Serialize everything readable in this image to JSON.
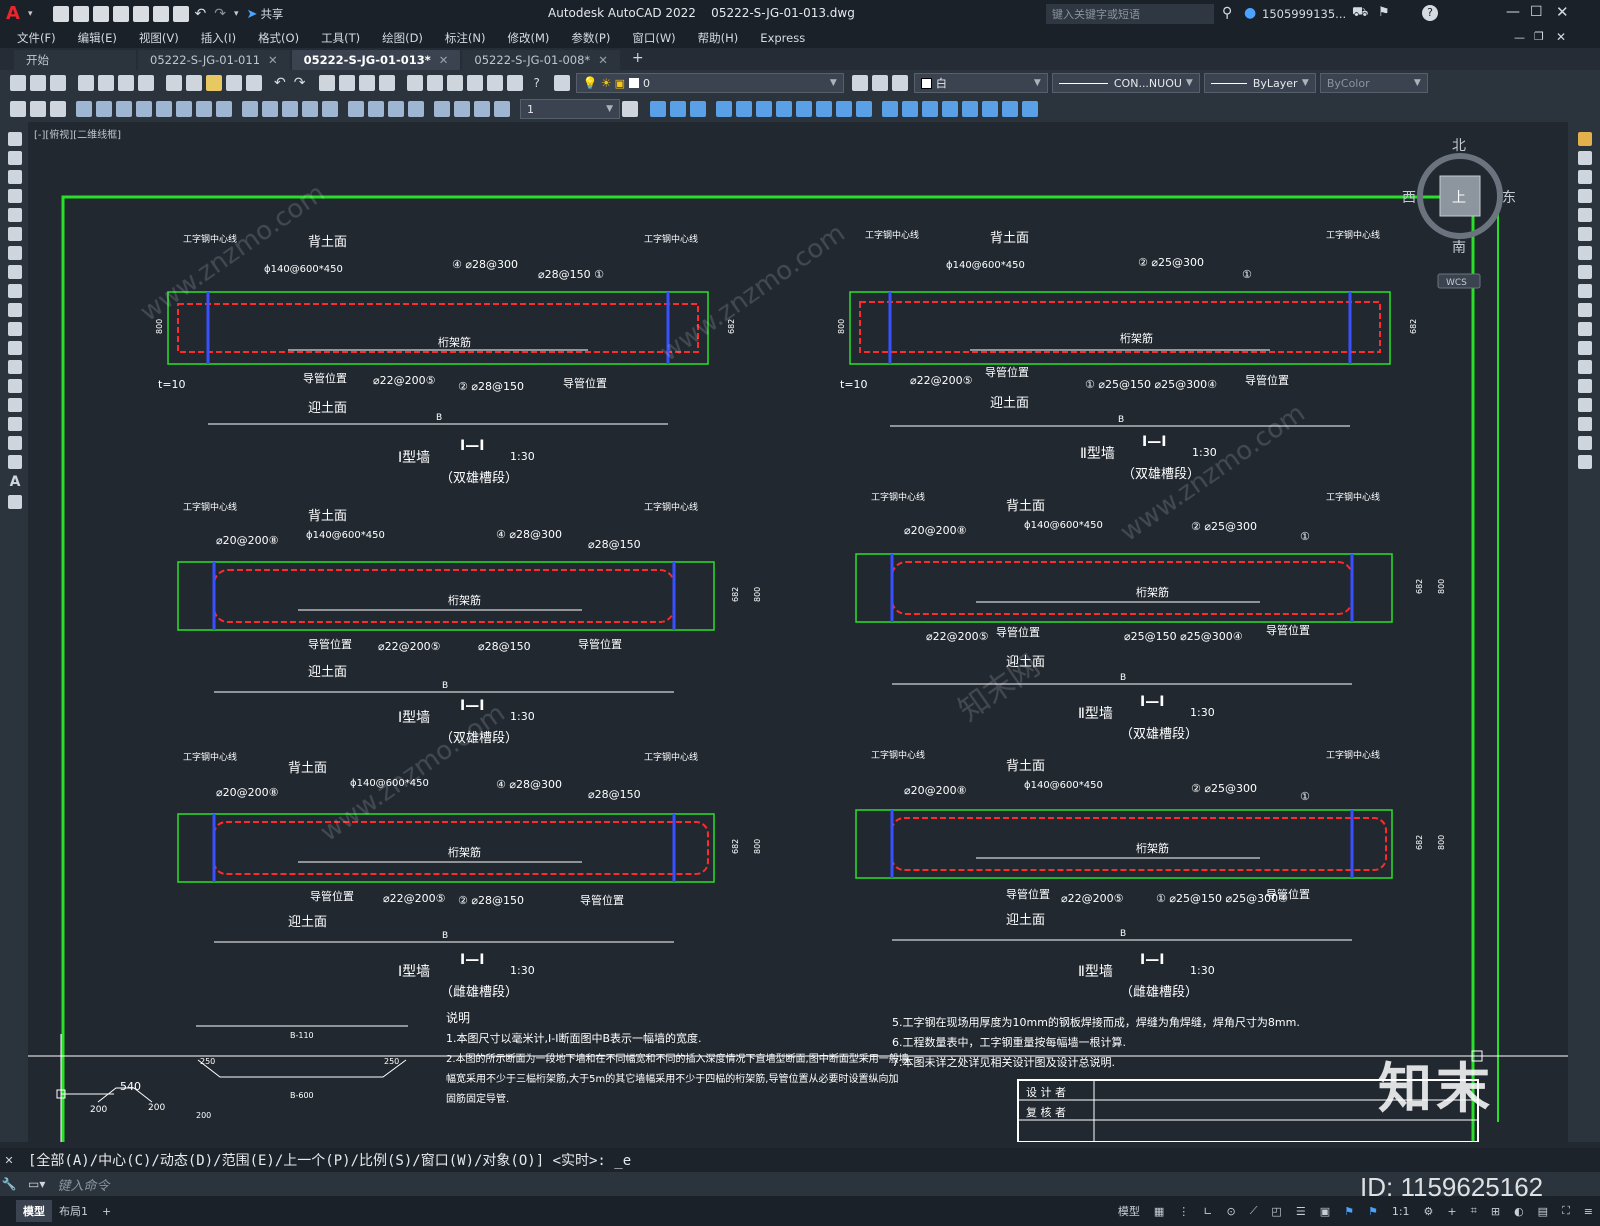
{
  "app": {
    "title": "Autodesk AutoCAD 2022    05222-S-JG-01-013.dwg",
    "share_label": "共享",
    "search_placeholder": "键入关键字或短语",
    "user": "1505999135...",
    "accent_color": "#e8262c"
  },
  "menu": [
    "文件(F)",
    "编辑(E)",
    "视图(V)",
    "插入(I)",
    "格式(O)",
    "工具(T)",
    "绘图(D)",
    "标注(N)",
    "修改(M)",
    "参数(P)",
    "窗口(W)",
    "帮助(H)",
    "Express"
  ],
  "tabs": [
    {
      "label": "开始",
      "close": ""
    },
    {
      "label": "05222-S-JG-01-011",
      "close": "✕"
    },
    {
      "label": "05222-S-JG-01-013*",
      "close": "✕",
      "active": true
    },
    {
      "label": "05222-S-JG-01-008*",
      "close": "✕"
    }
  ],
  "toolbar": {
    "layer_value": "0",
    "color_value": "白",
    "linetype_value": "CON...NUOU",
    "lineweight_value": "ByLayer",
    "plotstyle_value": "ByColor",
    "scale_value": "1"
  },
  "viewport": {
    "label": "[-][俯视][二维线框]",
    "compass": {
      "north": "北",
      "south": "南",
      "east": "东",
      "west": "西",
      "top": "上",
      "wcs": "WCS"
    }
  },
  "drawing": {
    "sections": [
      {
        "type_label": "Ⅰ型墙",
        "scale_mark": "Ⅰ—Ⅰ",
        "scale": "1:30",
        "subtitle": "（双雄槽段）",
        "back_face": "背土面",
        "front_face": "迎土面",
        "center_line": "工字钢中心线",
        "frame_bar": "桁架筋",
        "guide_pipe": "导管位置",
        "rebar_top1": "④ ⌀28@300",
        "rebar_top2": "⌀28@150 ①",
        "rebar_bot1": "⌀22@200⑤",
        "rebar_bot2": "② ⌀28@150",
        "pipe_spec": "ϕ140@600*450",
        "dim_b": "B",
        "dim_800": "800",
        "dim_682": "682",
        "thickness": "t=10"
      },
      {
        "type_label": "Ⅱ型墙",
        "scale_mark": "Ⅰ—Ⅰ",
        "scale": "1:30",
        "subtitle": "（双雄槽段）",
        "back_face": "背土面",
        "front_face": "迎土面",
        "center_line": "工字钢中心线",
        "frame_bar": "桁架筋",
        "guide_pipe": "导管位置",
        "rebar_top1": "② ⌀25@300",
        "rebar_top2": "①",
        "rebar_bot1": "⌀22@200⑤",
        "rebar_bot2": "① ⌀25@150 ⌀25@300④",
        "pipe_spec": "ϕ140@600*450",
        "dim_b": "B",
        "dim_800": "800",
        "dim_682": "682",
        "thickness": "t=10"
      },
      {
        "type_label": "Ⅰ型墙",
        "scale_mark": "Ⅰ—Ⅰ",
        "scale": "1:30",
        "subtitle": "（双雄槽段）",
        "back_face": "背土面",
        "front_face": "迎土面",
        "center_line": "工字钢中心线",
        "frame_bar": "桁架筋",
        "guide_pipe": "导管位置",
        "rebar_top1": "④ ⌀28@300",
        "rebar_top2": "⌀28@150",
        "rebar_bot1": "⌀22@200⑤",
        "rebar_bot2": "⌀28@150",
        "pipe_spec": "ϕ140@600*450",
        "dim_b": "B",
        "dim_800": "800",
        "dim_682": "682",
        "thickness": "⌀20@200⑧"
      },
      {
        "type_label": "Ⅱ型墙",
        "scale_mark": "Ⅰ—Ⅰ",
        "scale": "1:30",
        "subtitle": "（双雄槽段）",
        "back_face": "背土面",
        "front_face": "迎土面",
        "center_line": "工字钢中心线",
        "frame_bar": "桁架筋",
        "guide_pipe": "导管位置",
        "rebar_top1": "② ⌀25@300",
        "rebar_top2": "①",
        "rebar_bot1": "⌀22@200⑤",
        "rebar_bot2": "⌀25@150 ⌀25@300④",
        "pipe_spec": "ϕ140@600*450",
        "dim_b": "B",
        "dim_800": "800",
        "dim_682": "682",
        "thickness": "⌀20@200⑧"
      },
      {
        "type_label": "Ⅰ型墙",
        "scale_mark": "Ⅰ—Ⅰ",
        "scale": "1:30",
        "subtitle": "（雌雄槽段）",
        "back_face": "背土面",
        "front_face": "迎土面",
        "center_line": "工字钢中心线",
        "frame_bar": "桁架筋",
        "guide_pipe": "导管位置",
        "rebar_top1": "④ ⌀28@300",
        "rebar_top2": "⌀28@150",
        "rebar_bot1": "⌀22@200⑤",
        "rebar_bot2": "② ⌀28@150",
        "pipe_spec": "ϕ140@600*450",
        "dim_b": "B",
        "dim_800": "800",
        "dim_682": "682",
        "thickness": "⌀20@200⑧"
      },
      {
        "type_label": "Ⅱ型墙",
        "scale_mark": "Ⅰ—Ⅰ",
        "scale": "1:30",
        "subtitle": "（雌雄槽段）",
        "back_face": "背土面",
        "front_face": "迎土面",
        "center_line": "工字钢中心线",
        "frame_bar": "桁架筋",
        "guide_pipe": "导管位置",
        "rebar_top1": "② ⌀25@300",
        "rebar_top2": "①",
        "rebar_bot1": "⌀22@200⑤",
        "rebar_bot2": "① ⌀25@150 ⌀25@300④",
        "pipe_spec": "ϕ140@600*450",
        "dim_b": "B",
        "dim_800": "800",
        "dim_682": "682",
        "thickness": "⌀20@200⑧"
      }
    ],
    "notes_title": "说明",
    "notes": [
      "1.本图尺寸以毫米计,Ⅰ-Ⅰ断面图中B表示一幅墙的宽度.",
      "2.本图的所示断面为一段地下墙和在不同幅宽和不同的插入深度情况下直墙型断面,图中断面型采用一般墙",
      "幅宽采用不少于三榀桁架筋,大于5m的其它墙幅采用不少于四榀的桁架筋,导管位置从必要时设置纵向加",
      "固筋固定导管."
    ],
    "notes_right": [
      "5.工字钢在现场用厚度为10mm的钢板焊接而成，焊缝为角焊缝，焊角尺寸为8mm.",
      "6.工程数量表中，工字钢重量按每幅墙一根计算.",
      "7.本图未详之处详见相关设计图及设计总说明."
    ],
    "title_block": [
      "设 计 者",
      "复 核 者"
    ],
    "bar_labels": [
      "B-110",
      "B-600"
    ],
    "bar_dims": [
      "250",
      "250",
      "200",
      "540",
      "200",
      "200"
    ]
  },
  "command": {
    "prompt": "[全部(A)/中心(C)/动态(D)/范围(E)/上一个(P)/比例(S)/窗口(W)/对象(O)] <实时>: _e",
    "input_placeholder": "键入命令"
  },
  "status": {
    "tab_model": "模型",
    "tab_layout": "布局1",
    "model_label": "模型",
    "scale": "1:1"
  },
  "watermark": {
    "logo": "知末",
    "id": "ID: 1159625162",
    "site": "www.znzmo.com",
    "site_cn": "知末网"
  }
}
